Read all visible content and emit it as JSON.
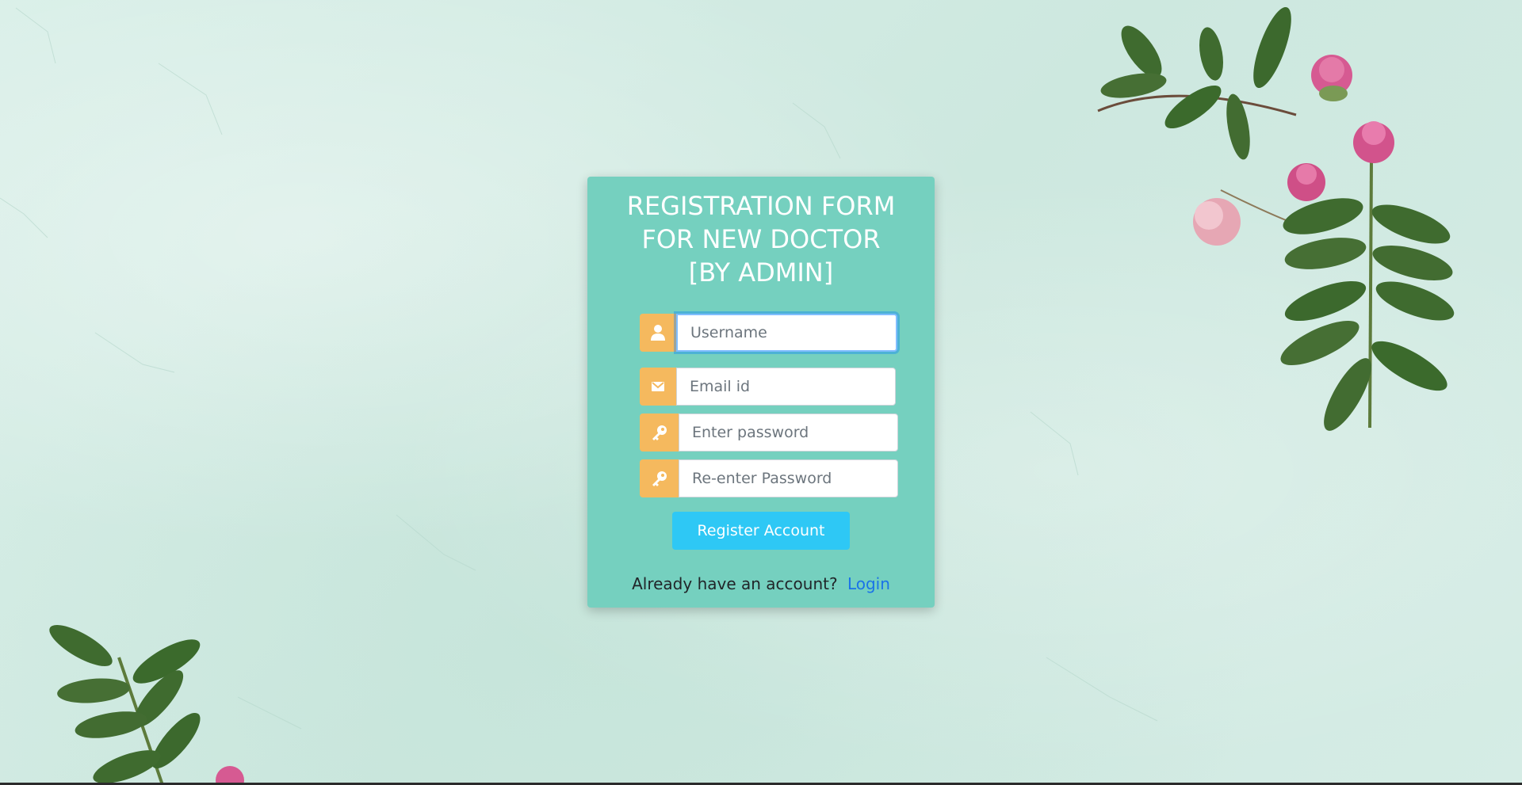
{
  "form": {
    "title": "REGISTRATION FORM\nFOR NEW DOCTOR\n   [BY ADMIN]",
    "fields": [
      {
        "name": "username",
        "placeholder": "Username",
        "icon": "user-icon"
      },
      {
        "name": "email",
        "placeholder": "Email id",
        "icon": "envelope-icon"
      },
      {
        "name": "password",
        "placeholder": "Enter password",
        "icon": "key-icon"
      },
      {
        "name": "confirm_password",
        "placeholder": "Re-enter Password",
        "icon": "key-icon"
      }
    ],
    "submit_label": "Register Account",
    "footer_text": "Already have an account?",
    "login_link": "Login"
  },
  "colors": {
    "card": "#75d0bf",
    "addon": "#f5b95e",
    "button": "#2ec8f5",
    "link": "#1a73e8"
  }
}
